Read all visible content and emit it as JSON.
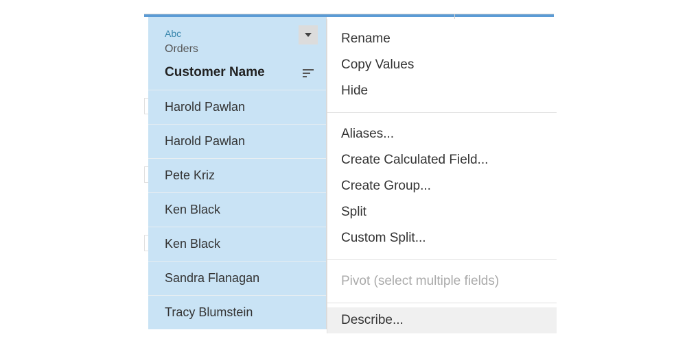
{
  "column": {
    "type_label": "Abc",
    "table_label": "Orders",
    "field_name": "Customer Name",
    "rows": [
      "Harold Pawlan",
      "Harold Pawlan",
      "Pete Kriz",
      "Ken Black",
      "Ken Black",
      "Sandra Flanagan",
      "Tracy Blumstein"
    ]
  },
  "menu": {
    "group1": {
      "rename": "Rename",
      "copy_values": "Copy Values",
      "hide": "Hide"
    },
    "group2": {
      "aliases": "Aliases...",
      "create_calc": "Create Calculated Field...",
      "create_group": "Create Group...",
      "split": "Split",
      "custom_split": "Custom Split..."
    },
    "group3": {
      "pivot": "Pivot (select multiple fields)"
    },
    "group4": {
      "describe": "Describe..."
    }
  }
}
